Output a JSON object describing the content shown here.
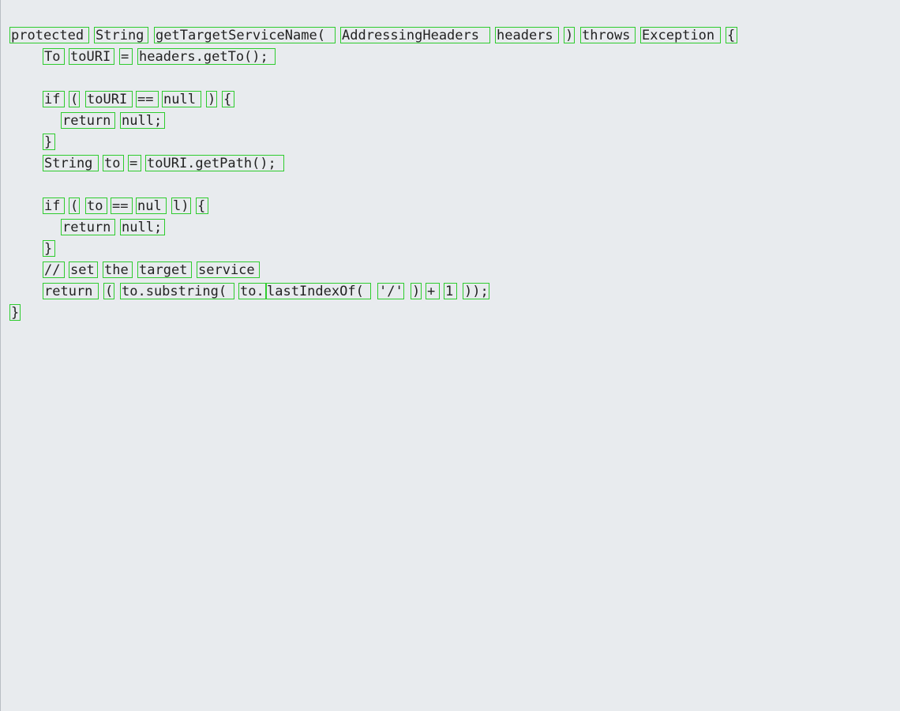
{
  "lines": [
    {
      "tokens": [
        {
          "text": "protected"
        },
        {
          "text": "String"
        },
        {
          "text": "getTargetServiceName("
        },
        {
          "text": "AddressingHeaders"
        },
        {
          "text": "headers"
        },
        {
          "text": ")"
        },
        {
          "text": "throws"
        },
        {
          "text": "Exception"
        },
        {
          "text": "{"
        }
      ]
    },
    {
      "tokens": [
        {
          "text": "To"
        },
        {
          "text": "toURI"
        },
        {
          "text": "="
        },
        {
          "text": "headers.getTo();"
        }
      ]
    },
    {
      "tokens": []
    },
    {
      "tokens": [
        {
          "text": "if"
        },
        {
          "text": "("
        },
        {
          "text": "toURI"
        },
        {
          "text": "=="
        },
        {
          "text": "null"
        },
        {
          "text": ")"
        },
        {
          "text": "{"
        }
      ]
    },
    {
      "tokens": [
        {
          "text": "return"
        },
        {
          "text": "null;"
        }
      ]
    },
    {
      "tokens": [
        {
          "text": "}"
        }
      ]
    },
    {
      "tokens": [
        {
          "text": "String"
        },
        {
          "text": "to"
        },
        {
          "text": "="
        },
        {
          "text": "toURI.getPath();"
        }
      ]
    },
    {
      "tokens": []
    },
    {
      "tokens": [
        {
          "text": "if"
        },
        {
          "text": "("
        },
        {
          "text": "to"
        },
        {
          "text": "=="
        },
        {
          "text": "nul"
        },
        {
          "text": "l)"
        },
        {
          "text": "{"
        }
      ]
    },
    {
      "tokens": [
        {
          "text": "return"
        },
        {
          "text": "null;"
        }
      ]
    },
    {
      "tokens": [
        {
          "text": "}"
        }
      ]
    },
    {
      "tokens": [
        {
          "text": "//"
        },
        {
          "text": "set"
        },
        {
          "text": "the"
        },
        {
          "text": "target"
        },
        {
          "text": "service"
        }
      ]
    },
    {
      "tokens": [
        {
          "text": "return"
        },
        {
          "text": "("
        },
        {
          "text": "to.substring("
        },
        {
          "text": "to."
        },
        {
          "text": "lastIndexOf("
        },
        {
          "text": "'/'"
        },
        {
          "text": ")"
        },
        {
          "text": "+"
        },
        {
          "text": "1"
        },
        {
          "text": "));"
        }
      ]
    },
    {
      "tokens": [
        {
          "text": "}"
        }
      ]
    }
  ]
}
